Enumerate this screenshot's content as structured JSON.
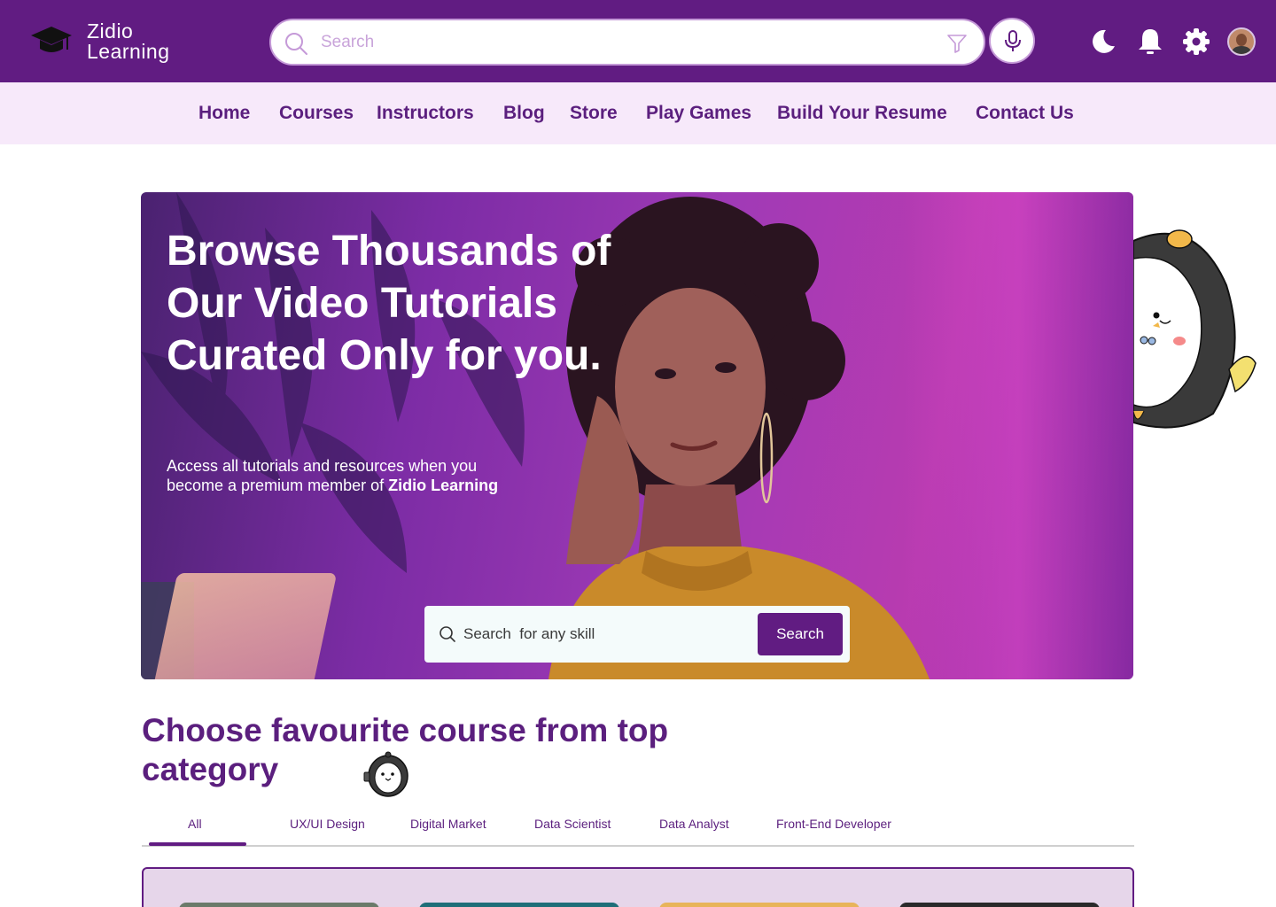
{
  "brand": {
    "line1": "Zidio",
    "line2": "Learning"
  },
  "header": {
    "search_placeholder": "Search"
  },
  "nav": {
    "items": [
      {
        "label": "Home"
      },
      {
        "label": "Courses"
      },
      {
        "label": "Instructors"
      },
      {
        "label": "Blog"
      },
      {
        "label": "Store"
      },
      {
        "label": "Play Games"
      },
      {
        "label": "Build Your Resume"
      },
      {
        "label": "Contact Us"
      }
    ]
  },
  "hero": {
    "title": "Browse Thousands of Our Video Tutorials Curated Only for you.",
    "subtitle_prefix": "Access all tutorials and resources when you become a premium member of ",
    "subtitle_brand": "Zidio Learning",
    "search_placeholder": "Search  for any skill",
    "search_button": "Search"
  },
  "categories": {
    "title": "Choose favourite course from top category",
    "tabs": [
      {
        "label": "All",
        "active": true
      },
      {
        "label": "UX/UI Design"
      },
      {
        "label": "Digital Market"
      },
      {
        "label": "Data Scientist"
      },
      {
        "label": "Data Analyst"
      },
      {
        "label": "Front-End Developer"
      }
    ]
  },
  "icons": {
    "logo": "graduation-cap-icon",
    "search": "search-icon",
    "filter": "filter-icon",
    "mic": "microphone-icon",
    "theme": "moon-icon",
    "notifications": "bell-icon",
    "settings": "gear-icon"
  },
  "colors": {
    "primary": "#611c82",
    "nav_bg": "#f7e9fa",
    "nav_text": "#5b1f7e",
    "search_border": "#c59ad8",
    "panel_bg": "#e6d6ea"
  }
}
